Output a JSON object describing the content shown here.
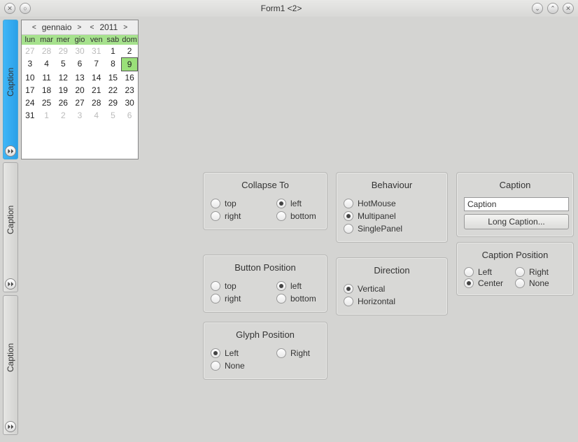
{
  "window": {
    "title": "Form1 <2>"
  },
  "sidebar": {
    "panels": [
      {
        "label": "Caption"
      },
      {
        "label": "Caption"
      },
      {
        "label": "Caption"
      }
    ]
  },
  "calendar": {
    "month": "gennaio",
    "year": "2011",
    "dow": [
      "lun",
      "mar",
      "mer",
      "gio",
      "ven",
      "sab",
      "dom"
    ],
    "leading": [
      27,
      28,
      29,
      30,
      31
    ],
    "days_count": 31,
    "trailing": [
      1,
      2,
      3,
      4,
      5,
      6
    ],
    "selected": 9
  },
  "groups": {
    "collapse_to": {
      "title": "Collapse To",
      "options": [
        "top",
        "left",
        "right",
        "bottom"
      ],
      "selected": "left"
    },
    "button_position": {
      "title": "Button Position",
      "options": [
        "top",
        "left",
        "right",
        "bottom"
      ],
      "selected": "left"
    },
    "glyph_position": {
      "title": "Glyph Position",
      "options": [
        "Left",
        "Right",
        "None"
      ],
      "selected": "Left"
    },
    "behaviour": {
      "title": "Behaviour",
      "options": [
        "HotMouse",
        "Multipanel",
        "SinglePanel"
      ],
      "selected": "Multipanel"
    },
    "direction": {
      "title": "Direction",
      "options": [
        "Vertical",
        "Horizontal"
      ],
      "selected": "Vertical"
    },
    "caption": {
      "title": "Caption",
      "input_value": "Caption",
      "button": "Long Caption..."
    },
    "caption_position": {
      "title": "Caption Position",
      "options": [
        "Left",
        "Right",
        "Center",
        "None"
      ],
      "selected": "Center"
    }
  }
}
